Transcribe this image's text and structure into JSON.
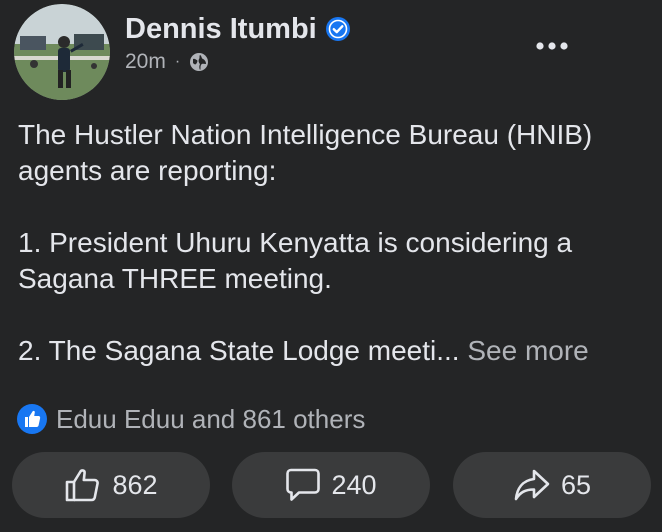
{
  "post": {
    "author": "Dennis Itumbi",
    "time": "20m",
    "separator": "·",
    "paragraphs": [
      "The Hustler Nation Intelligence Bureau (HNIB) agents are reporting:",
      "1. President Uhuru Kenyatta is considering a Sagana THREE meeting."
    ],
    "truncated_line": "2. The Sagana State Lodge meeti...",
    "see_more": "See more"
  },
  "reactions": {
    "summary": "Eduu Eduu and 861 others"
  },
  "actions": {
    "like_count": "862",
    "comment_count": "240",
    "share_count": "65"
  },
  "icons": {
    "verified": "verified-badge-icon",
    "privacy": "globe-icon",
    "more": "more-horizontal-icon",
    "reaction": "like-reaction-icon",
    "like": "thumbs-up-icon",
    "comment": "comment-bubble-icon",
    "share": "share-arrow-icon"
  },
  "colors": {
    "background": "#242526",
    "text": "#e4e6eb",
    "secondary_text": "#b0b3b8",
    "button_bg": "#3a3b3c",
    "verified_blue": "#1877f2"
  }
}
